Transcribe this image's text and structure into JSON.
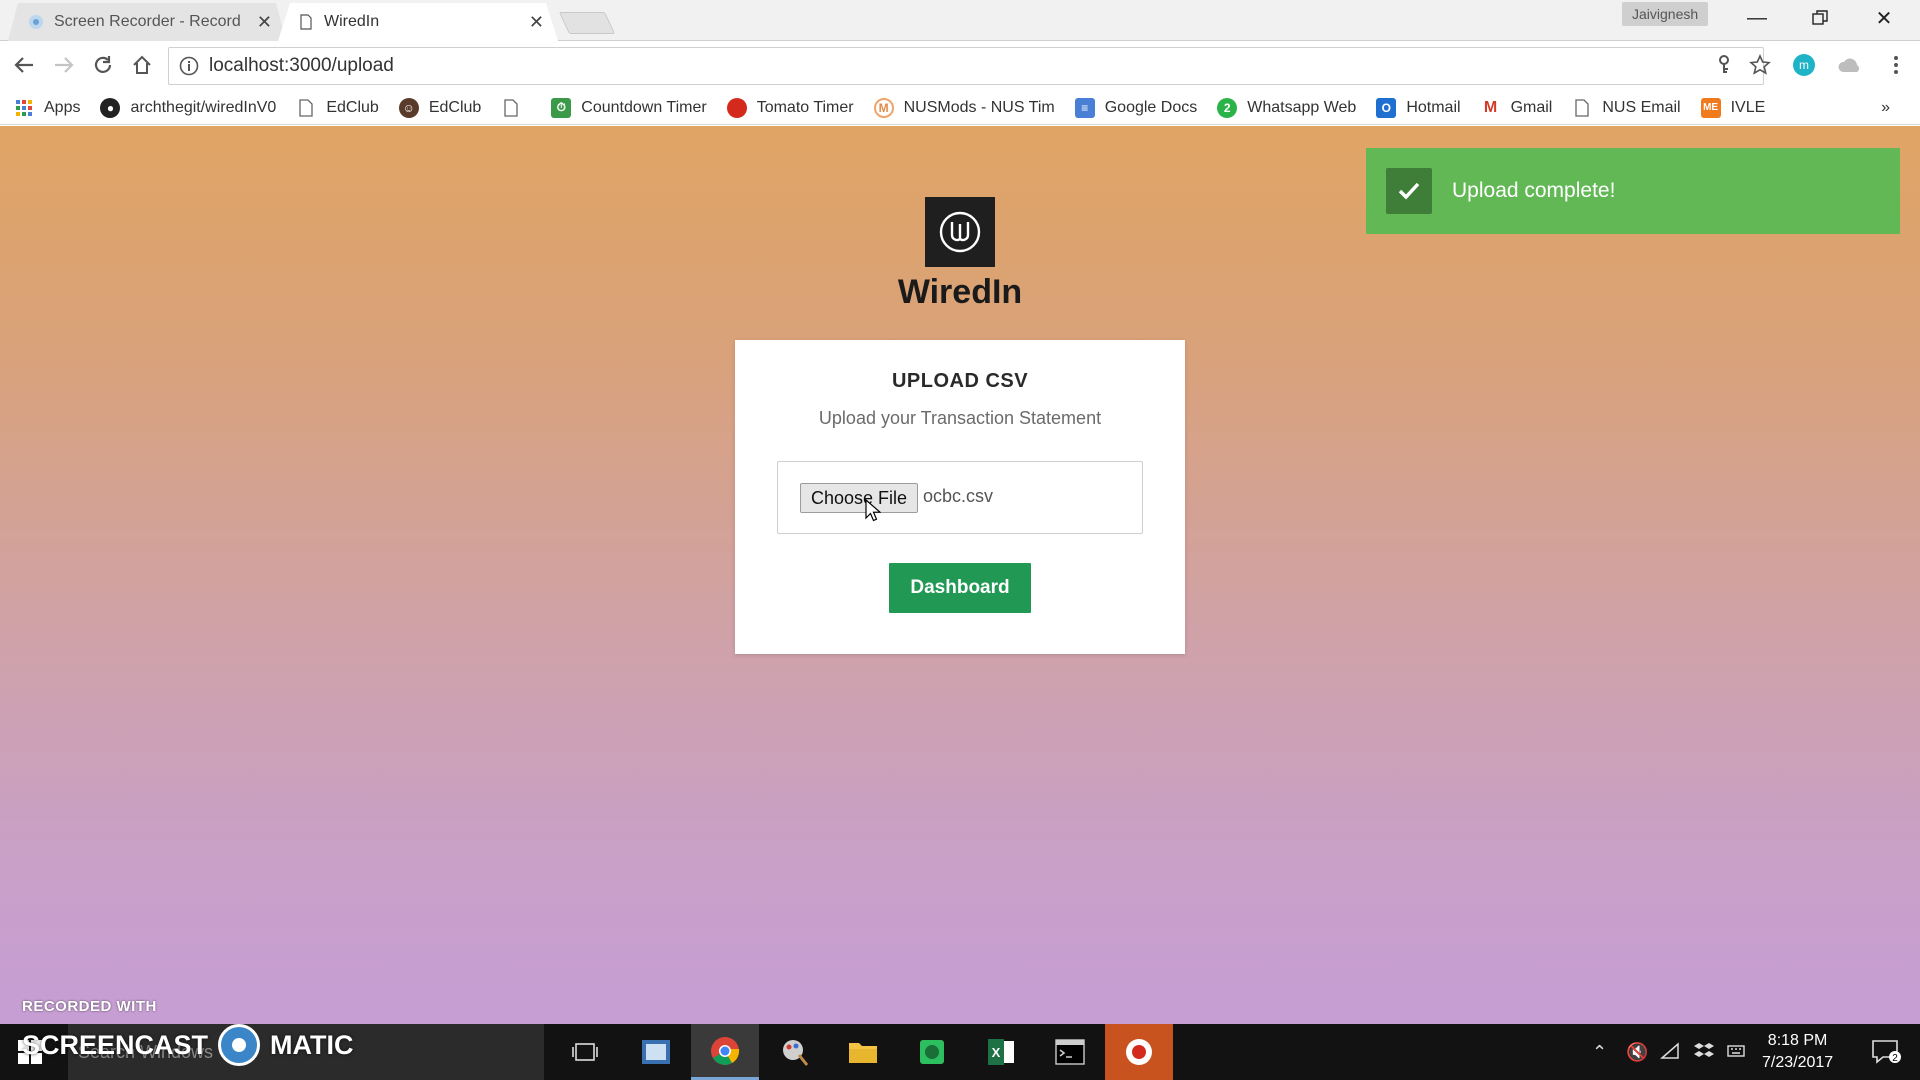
{
  "browser": {
    "tabs": [
      {
        "title": "Screen Recorder - Record"
      },
      {
        "title": "WiredIn"
      }
    ],
    "profile_name": "Jaivignesh",
    "url": "localhost:3000/upload",
    "bookmarks": [
      {
        "label": "Apps",
        "icon": "apps-grid-icon"
      },
      {
        "label": "archthegit/wiredInV0",
        "icon": "github-icon"
      },
      {
        "label": "EdClub",
        "icon": "page-icon"
      },
      {
        "label": "EdClub",
        "icon": "robot-icon"
      },
      {
        "label": "",
        "icon": "page-icon"
      },
      {
        "label": "Countdown Timer",
        "icon": "timer-icon"
      },
      {
        "label": "Tomato Timer",
        "icon": "tomato-icon"
      },
      {
        "label": "NUSMods - NUS Tim",
        "icon": "nusmods-icon"
      },
      {
        "label": "Google Docs",
        "icon": "docs-icon"
      },
      {
        "label": "Whatsapp Web",
        "icon": "whatsapp-icon"
      },
      {
        "label": "Hotmail",
        "icon": "outlook-icon"
      },
      {
        "label": "Gmail",
        "icon": "gmail-icon"
      },
      {
        "label": "NUS Email",
        "icon": "page-icon"
      },
      {
        "label": "IVLE",
        "icon": "ivle-icon"
      }
    ],
    "bookmarks_overflow": "»"
  },
  "page": {
    "brand": "WiredIn",
    "card": {
      "title": "UPLOAD CSV",
      "subtitle": "Upload your Transaction Statement",
      "choose_file_label": "Choose File",
      "file_name": "ocbc.csv",
      "dashboard_label": "Dashboard"
    },
    "toast": {
      "message": "Upload complete!"
    }
  },
  "watermark": {
    "line1": "RECORDED WITH",
    "left": "SCREENCAST",
    "right": "MATIC"
  },
  "taskbar": {
    "search_placeholder": "Search Windows",
    "time": "8:18 PM",
    "date": "7/23/2017",
    "notification_count": "2"
  },
  "colors": {
    "primary_button": "#229855",
    "toast_bg": "#62b855",
    "gradient_top": "#e0a464",
    "gradient_bottom": "#c69ed4"
  }
}
